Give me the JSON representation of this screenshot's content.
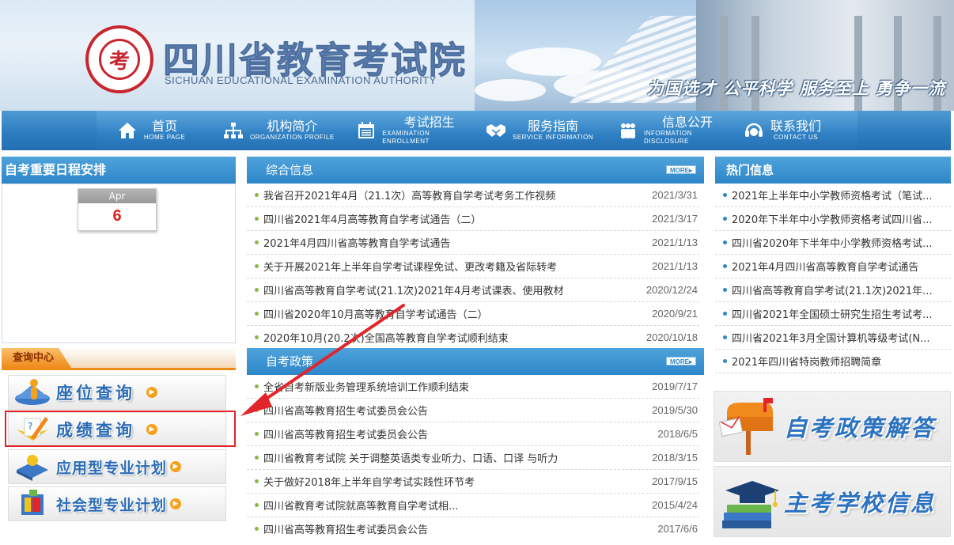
{
  "header": {
    "title": "四川省教育考试院",
    "subtitle": "SICHUAN EDUCATIONAL EXAMINATION AUTHORITY",
    "slogan": "为国选才 公平科学 服务至上 勇争一流"
  },
  "nav": [
    {
      "cn": "首页",
      "en": "HOME PAGE",
      "icon": "home-icon"
    },
    {
      "cn": "机构简介",
      "en": "ORGANIZATION PROFILE",
      "icon": "org-chart-icon"
    },
    {
      "cn": "考试招生",
      "en": "EXAMINATION ENROLLMENT",
      "icon": "calendar-icon"
    },
    {
      "cn": "服务指南",
      "en": "SERVICE INFORMATION",
      "icon": "handshake-icon"
    },
    {
      "cn": "信息公开",
      "en": "INFORMATION DISCLOSURE",
      "icon": "people-icon"
    },
    {
      "cn": "联系我们",
      "en": "CONTACT US",
      "icon": "headset-icon"
    }
  ],
  "schedule": {
    "title": "自考重要日程安排",
    "month": "Apr",
    "day": "6"
  },
  "query": {
    "title": "查询中心",
    "buttons": [
      {
        "label": "座位查询"
      },
      {
        "label": "成绩查询"
      },
      {
        "label": "应用型专业计划"
      },
      {
        "label": "社会型专业计划"
      }
    ]
  },
  "general": {
    "title": "综合信息",
    "more": "MORE",
    "items": [
      {
        "title": "我省召开2021年4月（21.1次）高等教育自学考试考务工作视频",
        "date": "2021/3/31"
      },
      {
        "title": "四川省2021年4月高等教育自学考试通告（二）",
        "date": "2021/3/17"
      },
      {
        "title": "2021年4月四川省高等教育自学考试通告",
        "date": "2021/1/13"
      },
      {
        "title": "关于开展2021年上半年自学考试课程免试、更改考籍及省际转考",
        "date": "2021/1/13"
      },
      {
        "title": "四川省高等教育自学考试(21.1次)2021年4月考试课表、使用教材",
        "date": "2020/12/24"
      },
      {
        "title": "四川省2020年10月高等教育自学考试通告（二）",
        "date": "2020/9/21"
      },
      {
        "title": "2020年10月(20.2次)全国高等教育自学考试顺利结束",
        "date": "2020/10/18"
      }
    ]
  },
  "policy": {
    "title": "自考政策",
    "more": "MORE",
    "items": [
      {
        "title": "全省自考新版业务管理系统培训工作顺利结束",
        "date": "2019/7/17"
      },
      {
        "title": "四川省高等教育招生考试委员会公告",
        "date": "2019/5/30"
      },
      {
        "title": "四川省高等教育招生考试委员会公告",
        "date": "2018/6/5"
      },
      {
        "title": "四川省教育考试院 关于调整英语类专业听力、口语、口译 与听力",
        "date": "2018/3/15"
      },
      {
        "title": "关于做好2018年上半年自学考试实践性环节考",
        "date": "2017/9/15"
      },
      {
        "title": "四川省教育考试院就高等教育自学考试相...",
        "date": "2015/4/24"
      },
      {
        "title": "四川省高等教育招生考试委员会公告",
        "date": "2017/6/6"
      }
    ]
  },
  "hot": {
    "title": "热门信息",
    "items": [
      {
        "title": "2021年上半年中小学教师资格考试（笔试..."
      },
      {
        "title": "2020年下半年中小学教师资格考试四川省..."
      },
      {
        "title": "四川省2020年下半年中小学教师资格考试..."
      },
      {
        "title": "2021年4月四川省高等教育自学考试通告"
      },
      {
        "title": "四川省高等教育自学考试(21.1次)2021年..."
      },
      {
        "title": "四川省2021年全国硕士研究生招生考试考..."
      },
      {
        "title": "四川省2021年3月全国计算机等级考试(N..."
      },
      {
        "title": "2021年四川省特岗教师招聘简章"
      }
    ]
  },
  "banners": [
    {
      "label": "自考政策解答",
      "icon": "mailbox-icon"
    },
    {
      "label": "主考学校信息",
      "icon": "graduation-cap-icon"
    }
  ],
  "colors": {
    "accent": "#2e86c8",
    "highlight": "#e2252b",
    "query_orange": "#f08a1c",
    "date_red": "#e0201c"
  }
}
